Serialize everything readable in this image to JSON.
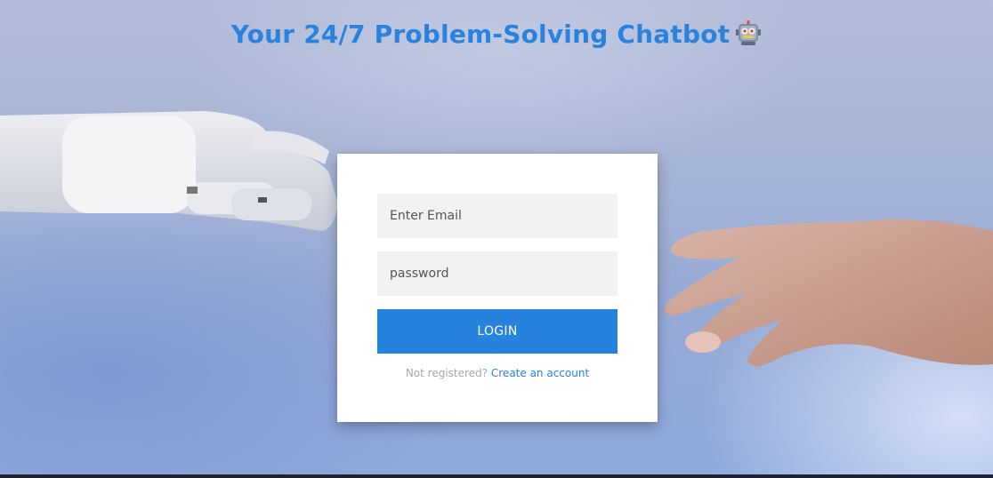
{
  "header": {
    "title": "Your 24/7 Problem-Solving Chatbot"
  },
  "icons": {
    "title_icon": "robot-face-icon"
  },
  "login_form": {
    "email_placeholder": "Enter Email",
    "password_placeholder": "password",
    "login_label": "LOGIN",
    "register_prompt": "Not registered?",
    "register_link": "Create an account"
  },
  "colors": {
    "accent": "#2583dd",
    "title": "#2a82df"
  }
}
